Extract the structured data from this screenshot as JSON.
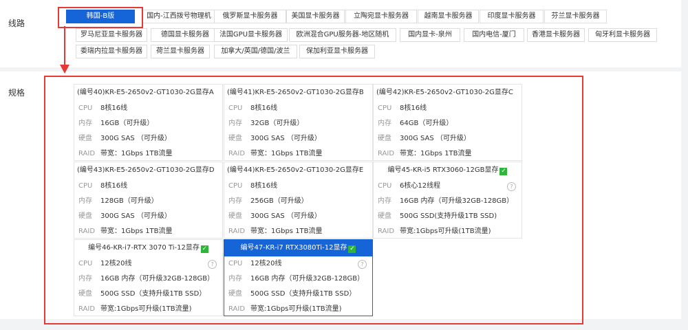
{
  "route_label": "线路",
  "spec_label": "规格",
  "routes": [
    "韩国-B版",
    "国内-江西拨号物理机",
    "俄罗斯显卡服务器",
    "美国显卡服务器",
    "立陶宛显卡服务器",
    "越南显卡服务器",
    "印度显卡服务器",
    "芬兰显卡服务器",
    "罗马尼亚显卡服务器",
    "德国显卡服务器",
    "法国GPU显卡服务器",
    "欧洲混合GPU服务器-地区随机",
    "国内显卡-泉州",
    "国内电信-厦门",
    "香港显卡服务器",
    "匈牙利显卡服务器",
    "委瑞内拉显卡服务器",
    "荷兰显卡服务器",
    "加拿大/英国/德国/波兰",
    "保加利亚显卡服务器"
  ],
  "active_route_index": 0,
  "spec_keys": {
    "cpu": "CPU",
    "mem": "内存",
    "disk": "硬盘",
    "raid": "RAID"
  },
  "specs": [
    {
      "title": "(编号40)KR-E5-2650v2-GT1030-2G显存A",
      "cpu": "8核16线",
      "mem": "16GB（可升级）",
      "disk": "300G SAS （可升级）",
      "raid": "带宽：1Gbps 1TB流量"
    },
    {
      "title": "(编号41)KR-E5-2650v2-GT1030-2G显存B",
      "cpu": "8核16线",
      "mem": "32GB（可升级）",
      "disk": "300G SAS （可升级）",
      "raid": "带宽：1Gbps 1TB流量"
    },
    {
      "title": "(编号42)KR-E5-2650v2-GT1030-2G显存C",
      "cpu": "8核16线",
      "mem": "64GB（可升级）",
      "disk": "300G SAS （可升级）",
      "raid": "带宽：1Gbps 1TB流量"
    },
    {
      "title": "(编号43)KR-E5-2650v2-GT1030-2G显存D",
      "cpu": "8核16线",
      "mem": "128GB（可升级）",
      "disk": "300G SAS （可升级）",
      "raid": "带宽：1Gbps 1TB流量"
    },
    {
      "title": "(编号44)KR-E5-2650v2-GT1030-2G显存E",
      "cpu": "8核16线",
      "mem": "256GB（可升级）",
      "disk": "300G SAS （可升级）",
      "raid": "带宽：1Gbps 1TB流量"
    },
    {
      "title": "编号45-KR-i5 RTX3060-12GB显存",
      "cpu": "6核心12线程",
      "mem": "16GB 内存（可升级32GB-128GB）",
      "disk": "500G SSD(支持升级1TB SSD)",
      "raid": "带宽:1Gbps可升级(1TB流量)"
    },
    {
      "title": "编号46-KR-i7-RTX 3070 Ti-12显存",
      "cpu": "12核20线",
      "mem": "16GB 内存（可升级32GB-128GB）",
      "disk": "500G SSD（支持升级1TB SSD）",
      "raid": "带宽:1Gbps可升级(1TB流量)"
    },
    {
      "title": "编号47-KR-i7 RTX3080Ti-12显存",
      "cpu": "12核20线",
      "mem": "16GB 内存（可升级32GB-128GB）",
      "disk": "500G SSD（支持升级1TB SSD）",
      "raid": "带宽:1Gbps可升级(1TB流量)"
    }
  ],
  "selected_spec_index": 7,
  "colors": {
    "accent": "#1565d8",
    "highlight": "#e53935",
    "check": "#2fb53a"
  }
}
